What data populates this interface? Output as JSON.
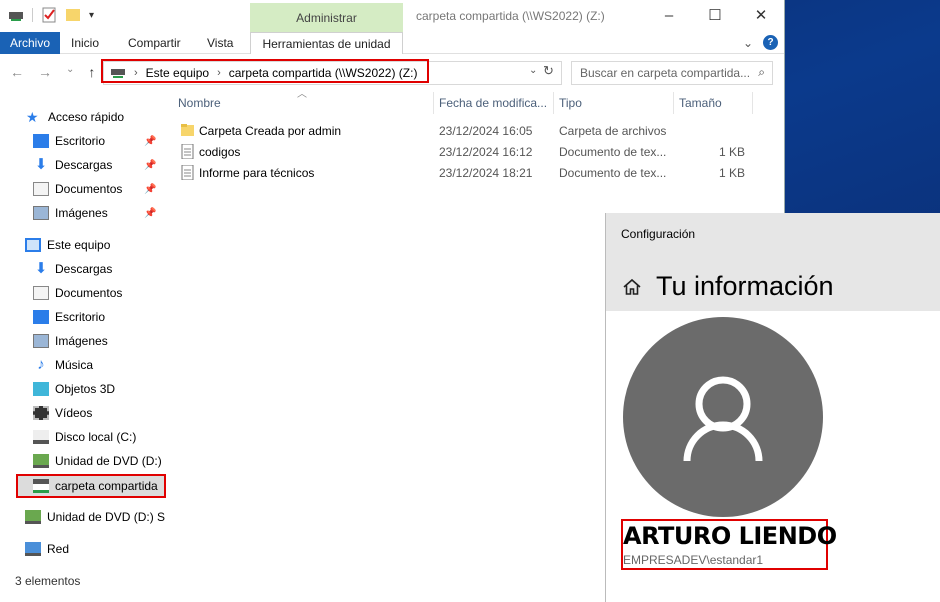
{
  "explorer": {
    "window_title": "carpeta compartida (\\\\WS2022) (Z:)",
    "context_tab_header": "Administrar",
    "ribbon_tabs": [
      "Archivo",
      "Inicio",
      "Compartir",
      "Vista",
      "Herramientas de unidad"
    ],
    "breadcrumb": [
      "Este equipo",
      "carpeta compartida (\\\\WS2022) (Z:)"
    ],
    "search_placeholder": "Buscar en carpeta compartida...",
    "columns": [
      "Nombre",
      "Fecha de modifica...",
      "Tipo",
      "Tamaño"
    ],
    "files": [
      {
        "name": "Carpeta Creada por admin",
        "date": "23/12/2024 16:05",
        "type": "Carpeta de archivos",
        "size": "",
        "icon": "folder-icon"
      },
      {
        "name": "codigos",
        "date": "23/12/2024 16:12",
        "type": "Documento de tex...",
        "size": "1 KB",
        "icon": "text-file-icon"
      },
      {
        "name": "Informe para técnicos",
        "date": "23/12/2024 18:21",
        "type": "Documento de tex...",
        "size": "1 KB",
        "icon": "text-file-icon"
      }
    ],
    "nav": {
      "quick_access": "Acceso rápido",
      "quick_items": [
        "Escritorio",
        "Descargas",
        "Documentos",
        "Imágenes"
      ],
      "this_pc": "Este equipo",
      "pc_items": [
        "Descargas",
        "Documentos",
        "Escritorio",
        "Imágenes",
        "Música",
        "Objetos 3D",
        "Vídeos",
        "Disco local (C:)",
        "Unidad de DVD (D:)",
        "carpeta compartida"
      ],
      "dvd_root": "Unidad de DVD (D:) S",
      "network": "Red"
    },
    "status": "3 elementos",
    "accent_color": "#1a62b5",
    "highlight_color": "#e00000"
  },
  "settings": {
    "app_title": "Configuración",
    "page_title": "Tu información",
    "user_name": "ARTURO LIENDO",
    "user_account": "EMPRESADEV\\estandar1"
  }
}
